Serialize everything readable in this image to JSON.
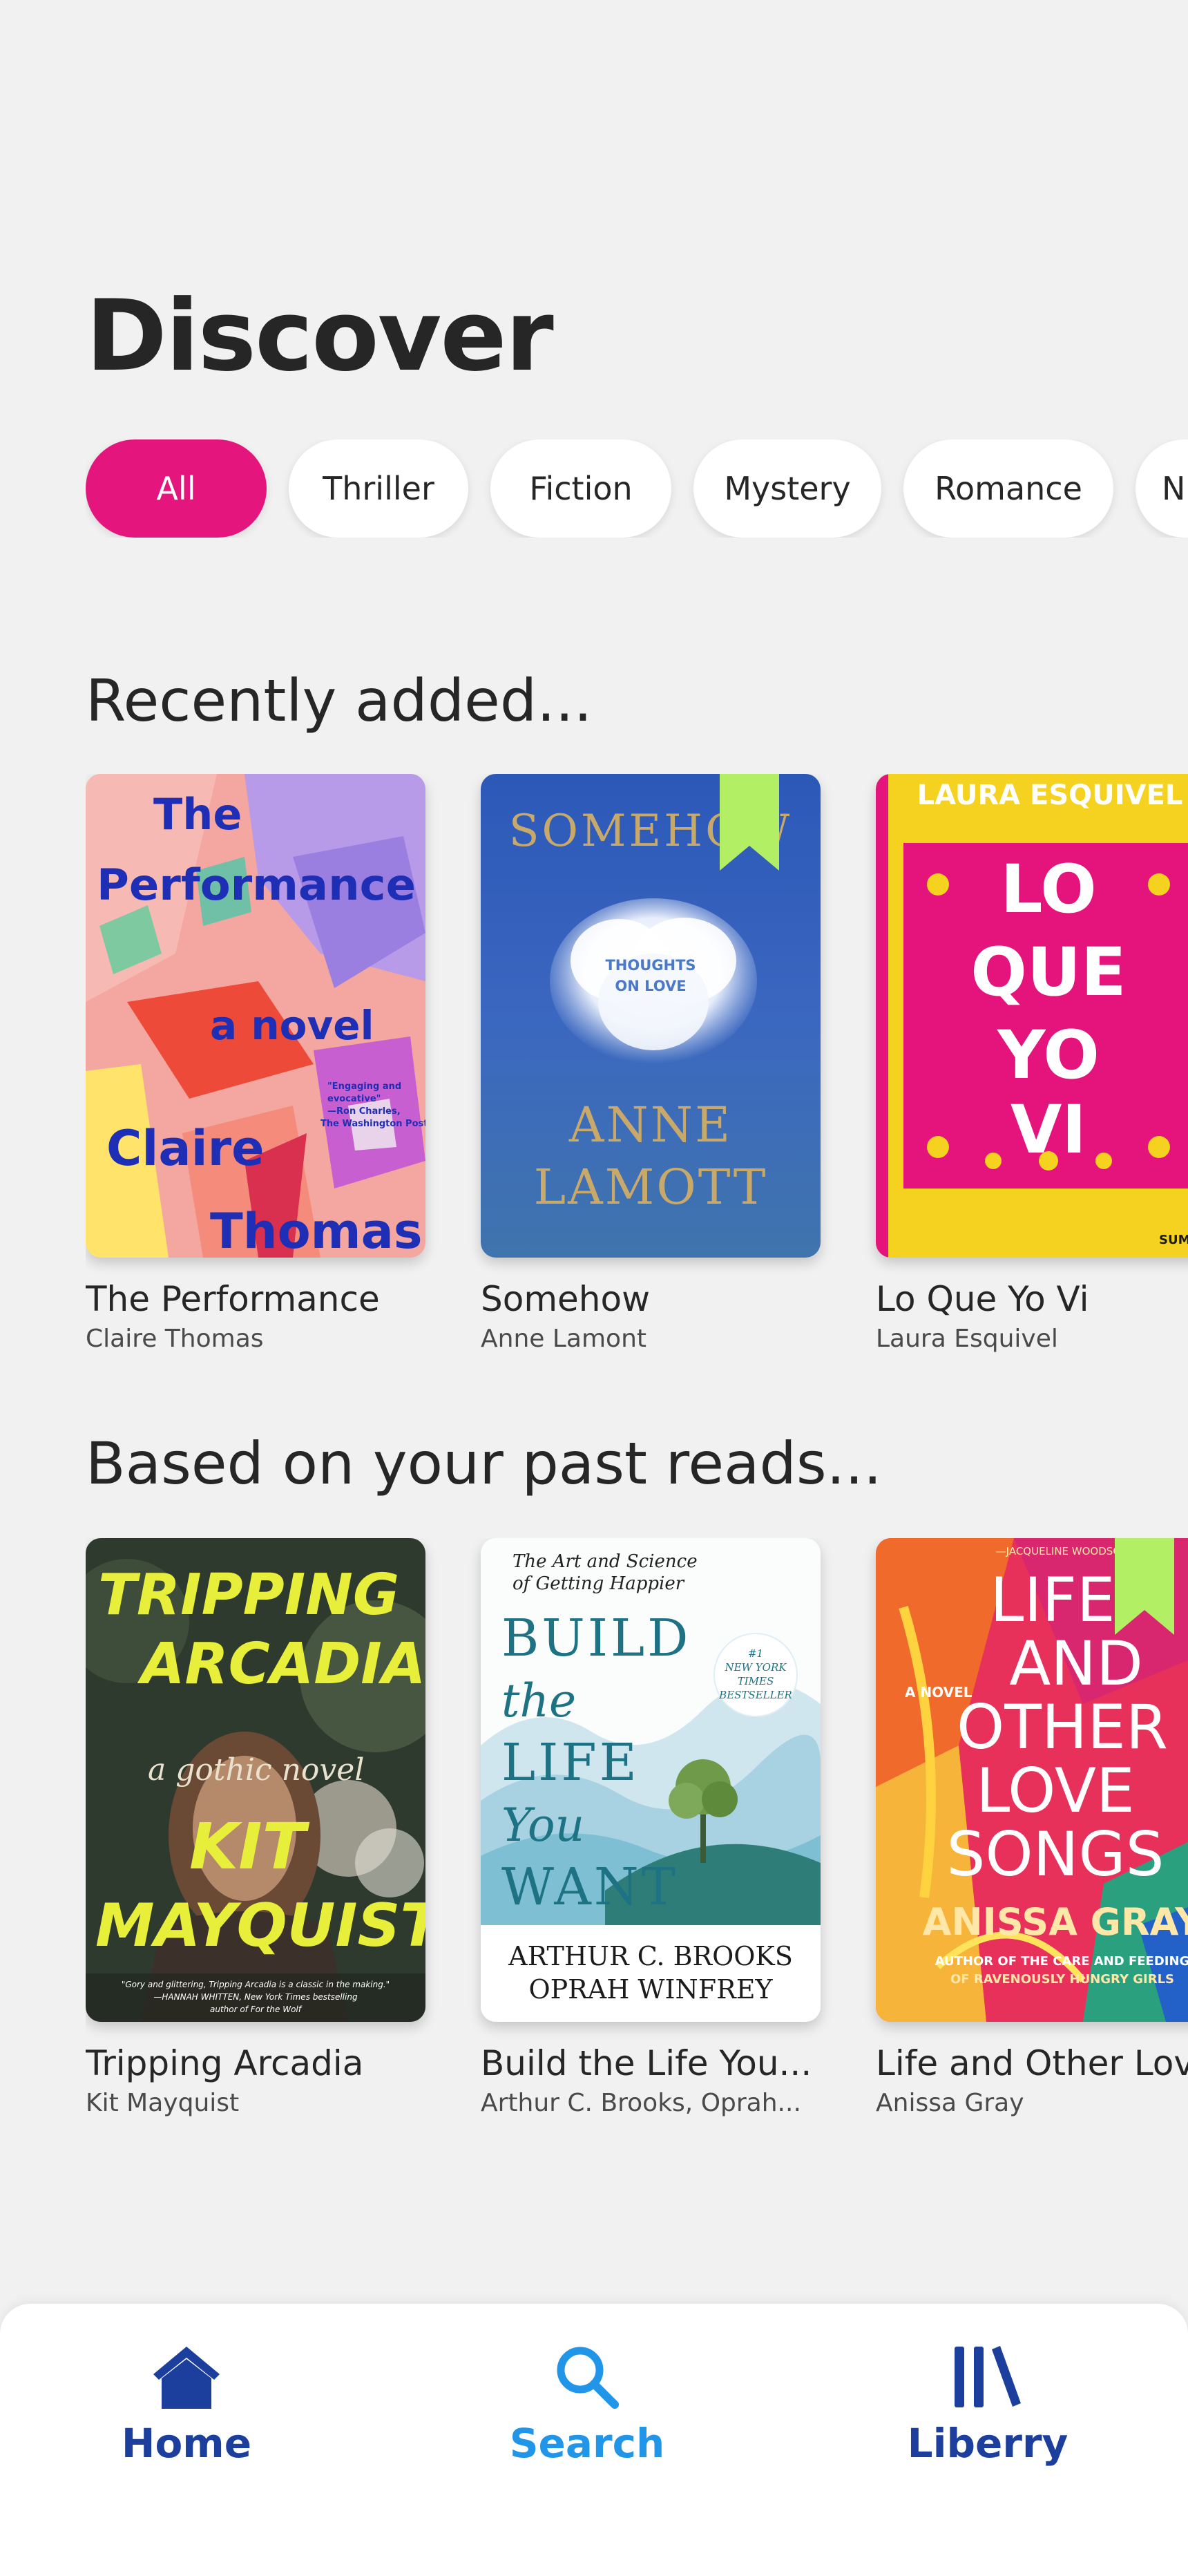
{
  "page": {
    "title": "Discover"
  },
  "filters": {
    "items": [
      {
        "label": "All",
        "active": true
      },
      {
        "label": "Thriller",
        "active": false
      },
      {
        "label": "Fiction",
        "active": false
      },
      {
        "label": "Mystery",
        "active": false
      },
      {
        "label": "Romance",
        "active": false
      },
      {
        "label": "N",
        "active": false
      }
    ]
  },
  "recently_added": {
    "heading": "Recently added...",
    "books": [
      {
        "title": "The Performance",
        "author": "Claire Thomas",
        "cover": {
          "lines": [
            "The",
            "Performance",
            "a novel",
            "Claire",
            "Thomas"
          ],
          "blurb": [
            "\"Engaging and",
            "evocative\"",
            "—Ron Charles,",
            "The Washington Post"
          ]
        }
      },
      {
        "title": "Somehow",
        "author": "Anne Lamont",
        "bookmarked": true,
        "cover": {
          "top": "SOMEHOW",
          "sub": [
            "THOUGHTS",
            "ON LOVE"
          ],
          "author": [
            "ANNE",
            "LAMOTT"
          ]
        }
      },
      {
        "title": "Lo Que Yo Vi",
        "author": "Laura Esquivel",
        "cover": {
          "top": "LAURA ESQUIVEL",
          "lines": [
            "LO",
            "QUE",
            "YO",
            "VI"
          ],
          "imprint": "SUMA"
        }
      }
    ]
  },
  "past_reads": {
    "heading": "Based on your past reads...",
    "books": [
      {
        "title": "Tripping Arcadia",
        "author": "Kit Mayquist",
        "cover": {
          "lines": [
            "TRIPPING",
            "ARCADIA",
            "a gothic novel",
            "KIT",
            "MAYQUIST"
          ],
          "blurb": [
            "\"Gory and glittering, Tripping Arcadia is a classic in the making.\"",
            "—HANNAH WHITTEN, New York Times bestselling",
            "author of For the Wolf"
          ]
        }
      },
      {
        "title": "Build the Life You...",
        "author": "Arthur C. Brooks, Oprah...",
        "cover": {
          "top": [
            "The Art and Science",
            "of Getting Happier"
          ],
          "lines": [
            "BUILD",
            "the",
            "LIFE",
            "You",
            "WANT"
          ],
          "badge": [
            "#1",
            "NEW YORK",
            "TIMES",
            "BESTSELLER"
          ],
          "authors": [
            "ARTHUR C. BROOKS",
            "OPRAH WINFREY"
          ]
        }
      },
      {
        "title": "Life and Other Love Songs",
        "author": "Anissa Gray",
        "bookmarked": true,
        "cover": {
          "top": "—JACQUELINE WOODSON",
          "label": "A NOVEL",
          "lines": [
            "LIFE",
            "AND",
            "OTHER",
            "LOVE",
            "SONGS"
          ],
          "author": "ANISSA GRAY",
          "footer": [
            "AUTHOR OF THE CARE AND FEEDING",
            "OF RAVENOUSLY HUNGRY GIRLS"
          ]
        }
      }
    ]
  },
  "nav": {
    "items": [
      {
        "label": "Home",
        "icon": "home-icon",
        "color": "#1c3f9e"
      },
      {
        "label": "Search",
        "icon": "search-icon",
        "color": "#2196e8"
      },
      {
        "label": "Liberry",
        "icon": "library-icon",
        "color": "#1c3f9e"
      }
    ]
  },
  "colors": {
    "accent": "#e4167d",
    "bookmark": "#b3ef64",
    "nav_active": "#2196e8",
    "nav_default": "#1c3f9e"
  }
}
